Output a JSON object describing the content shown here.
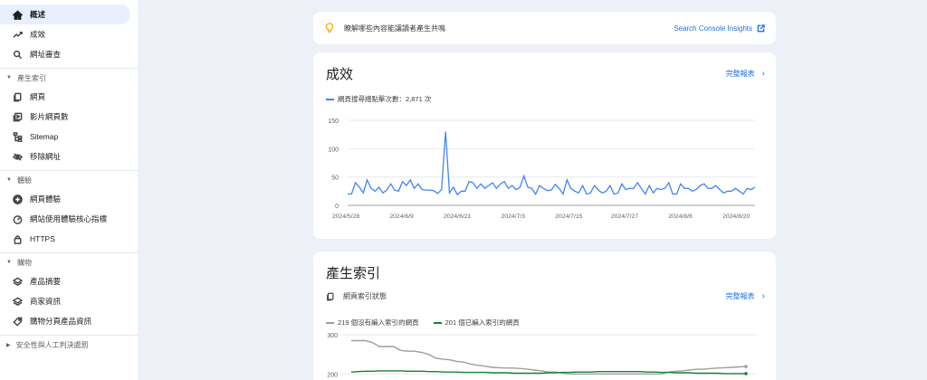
{
  "sidebar": {
    "items_top": [
      {
        "label": "概述",
        "icon": "home-icon",
        "active": true
      },
      {
        "label": "成效",
        "icon": "trending-icon",
        "active": false
      },
      {
        "label": "網址審查",
        "icon": "search-icon",
        "active": false
      }
    ],
    "sections": [
      {
        "title": "產生索引",
        "items": [
          {
            "label": "網頁",
            "icon": "page-icon"
          },
          {
            "label": "影片網頁數",
            "icon": "video-page-icon"
          },
          {
            "label": "Sitemap",
            "icon": "sitemap-icon"
          },
          {
            "label": "移除網址",
            "icon": "visibility-off-icon"
          }
        ]
      },
      {
        "title": "體驗",
        "items": [
          {
            "label": "網頁體驗",
            "icon": "add-circle-icon"
          },
          {
            "label": "網站使用體驗核心指標",
            "icon": "speed-icon"
          },
          {
            "label": "HTTPS",
            "icon": "lock-icon"
          }
        ]
      },
      {
        "title": "購物",
        "items": [
          {
            "label": "產品摘要",
            "icon": "layers-icon"
          },
          {
            "label": "商家資訊",
            "icon": "layers-icon"
          },
          {
            "label": "購物分頁產品資訊",
            "icon": "tag-icon"
          }
        ]
      },
      {
        "title": "安全性與人工判決處罰",
        "items": []
      }
    ]
  },
  "banner": {
    "text": "瞭解哪些內容能讓讀者產生共鳴",
    "link": "Search Console Insights"
  },
  "performance": {
    "title": "成效",
    "full_report": "完整報表",
    "legend": "網頁搜尋總點擊次數：2,871 次",
    "color": "#4285f4"
  },
  "indexing": {
    "title": "產生索引",
    "subheader": "網頁索引狀態",
    "full_report": "完整報表",
    "legend_not_indexed": "219 個沒有編入索引的網頁",
    "legend_indexed": "201 個已編入索引的網頁",
    "color_not_indexed": "#9e9e9e",
    "color_indexed": "#188038"
  },
  "chart_data": [
    {
      "type": "line",
      "title": "",
      "xlabel": "",
      "ylabel": "",
      "ylim": [
        0,
        150
      ],
      "yticks": [
        0,
        50,
        100,
        150
      ],
      "x_tick_labels": [
        "2024/5/28",
        "2024/6/9",
        "2024/6/21",
        "2024/7/3",
        "2024/7/15",
        "2024/7/27",
        "2024/8/8",
        "2024/8/20"
      ],
      "grid": true,
      "series": [
        {
          "name": "網頁搜尋總點擊次數",
          "color": "#4285f4",
          "values": [
            20,
            20,
            40,
            32,
            22,
            45,
            30,
            25,
            32,
            22,
            27,
            38,
            27,
            25,
            42,
            35,
            45,
            30,
            38,
            28,
            27,
            27,
            26,
            21,
            28,
            130,
            22,
            32,
            19,
            25,
            25,
            42,
            40,
            30,
            38,
            30,
            35,
            40,
            30,
            38,
            42,
            30,
            35,
            28,
            32,
            52,
            32,
            30,
            20,
            35,
            30,
            26,
            27,
            37,
            30,
            20,
            45,
            30,
            25,
            22,
            35,
            20,
            22,
            35,
            27,
            22,
            25,
            35,
            20,
            22,
            38,
            28,
            30,
            30,
            40,
            30,
            20,
            35,
            22,
            30,
            28,
            30,
            40,
            20,
            20,
            38,
            30,
            30,
            25,
            28,
            35,
            38,
            30,
            30,
            35,
            28,
            22,
            25,
            25,
            30,
            25,
            20,
            30,
            28,
            32
          ]
        }
      ]
    },
    {
      "type": "line",
      "title": "",
      "xlabel": "",
      "ylabel": "",
      "ylim": [
        180,
        300
      ],
      "yticks": [
        200,
        300
      ],
      "grid": true,
      "series": [
        {
          "name": "219 個沒有編入索引的網頁",
          "color": "#9e9e9e",
          "values": [
            285,
            285,
            285,
            280,
            270,
            270,
            270,
            260,
            258,
            258,
            255,
            250,
            240,
            238,
            236,
            232,
            230,
            225,
            222,
            220,
            217,
            216,
            215,
            215,
            214,
            212,
            210,
            208,
            205,
            205,
            202,
            200,
            200,
            200,
            200,
            200,
            200,
            200,
            200,
            200,
            200,
            200,
            200,
            200,
            200,
            205,
            207,
            208,
            210,
            212,
            212,
            214,
            215,
            216,
            217,
            218,
            219
          ]
        },
        {
          "name": "201 個已編入索引的網頁",
          "color": "#188038",
          "values": [
            205,
            206,
            207,
            207,
            208,
            208,
            208,
            208,
            207,
            207,
            207,
            206,
            206,
            205,
            205,
            205,
            204,
            204,
            204,
            204,
            203,
            203,
            203,
            202,
            202,
            202,
            202,
            202,
            203,
            203,
            204,
            204,
            205,
            205,
            205,
            206,
            206,
            206,
            206,
            206,
            206,
            206,
            205,
            205,
            204,
            204,
            203,
            203,
            203,
            202,
            202,
            202,
            202,
            201,
            201,
            201,
            201
          ]
        }
      ]
    }
  ]
}
